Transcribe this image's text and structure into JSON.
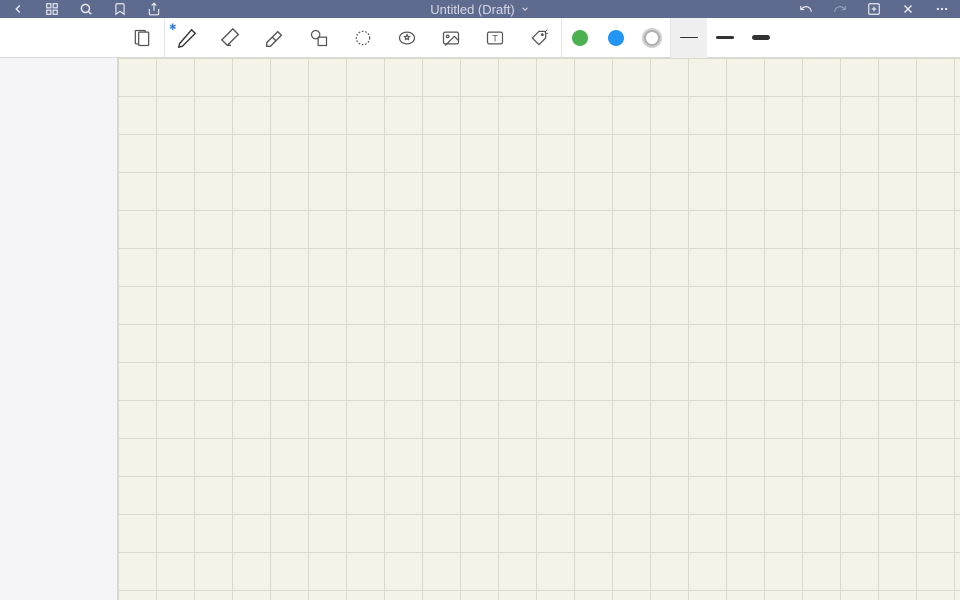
{
  "header": {
    "title": "Untitled (Draft)",
    "icons": {
      "back": "back-icon",
      "grid": "grid-icon",
      "search": "search-icon",
      "bookmark": "bookmark-icon",
      "share": "share-icon",
      "undo": "undo-icon",
      "redo": "redo-icon",
      "add": "add-page-icon",
      "close": "close-icon",
      "more": "more-icon"
    }
  },
  "toolbar": {
    "tools": [
      {
        "name": "document-tool",
        "icon": "document-icon"
      },
      {
        "name": "pen-tool",
        "icon": "pen-icon",
        "selected": true,
        "bluetooth": true
      },
      {
        "name": "eraser-tool",
        "icon": "eraser-icon"
      },
      {
        "name": "highlighter-tool",
        "icon": "highlighter-icon"
      },
      {
        "name": "shape-tool",
        "icon": "shape-icon"
      },
      {
        "name": "lasso-tool",
        "icon": "lasso-icon"
      },
      {
        "name": "stamp-tool",
        "icon": "stamp-icon"
      },
      {
        "name": "image-tool",
        "icon": "image-icon"
      },
      {
        "name": "text-tool",
        "icon": "text-icon"
      },
      {
        "name": "tag-tool",
        "icon": "tag-icon"
      }
    ],
    "colors": [
      {
        "name": "color-green",
        "hex": "#4CAF50"
      },
      {
        "name": "color-blue",
        "hex": "#2196F3"
      },
      {
        "name": "color-white",
        "hex": "#FFFFFF",
        "selected": true
      }
    ],
    "strokes": [
      {
        "name": "stroke-thin",
        "selected": true
      },
      {
        "name": "stroke-medium"
      },
      {
        "name": "stroke-thick"
      }
    ]
  },
  "canvas": {
    "background": "grid",
    "paper_color": "#f5f3e7"
  }
}
